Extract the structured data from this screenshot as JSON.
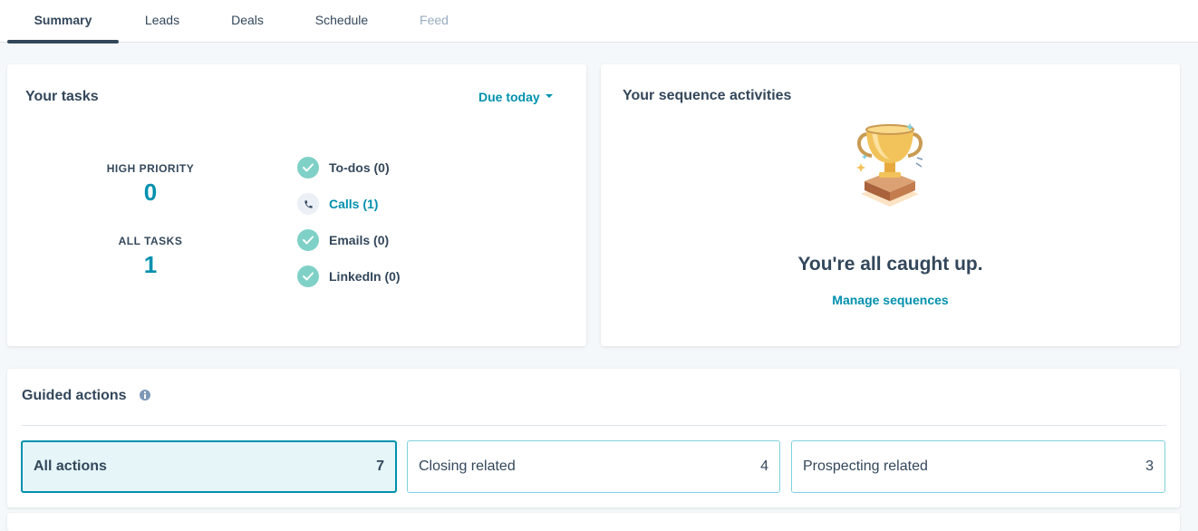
{
  "tabs": [
    {
      "label": "Summary",
      "active": true
    },
    {
      "label": "Leads"
    },
    {
      "label": "Deals"
    },
    {
      "label": "Schedule"
    },
    {
      "label": "Feed",
      "disabled": true
    }
  ],
  "tasks_card": {
    "title": "Your tasks",
    "filter": "Due today",
    "high_priority_label": "HIGH PRIORITY",
    "high_priority_value": "0",
    "all_tasks_label": "ALL TASKS",
    "all_tasks_value": "1",
    "items": [
      {
        "label": "To-dos (0)",
        "icon": "check-icon"
      },
      {
        "label": "Calls (1)",
        "icon": "phone-icon"
      },
      {
        "label": "Emails (0)",
        "icon": "check-icon"
      },
      {
        "label": "LinkedIn (0)",
        "icon": "check-icon"
      }
    ]
  },
  "sequence_card": {
    "title": "Your sequence activities",
    "message": "You're all caught up.",
    "link": "Manage sequences",
    "illustration": "trophy-illustration"
  },
  "guided_actions": {
    "title": "Guided actions",
    "filters": [
      {
        "label": "All actions",
        "count": "7",
        "active": true
      },
      {
        "label": "Closing related",
        "count": "4"
      },
      {
        "label": "Prospecting related",
        "count": "3"
      }
    ]
  },
  "colors": {
    "accent": "#0091ae",
    "text": "#33475b",
    "check": "#7fd1c7",
    "background": "#f5f8fa"
  }
}
